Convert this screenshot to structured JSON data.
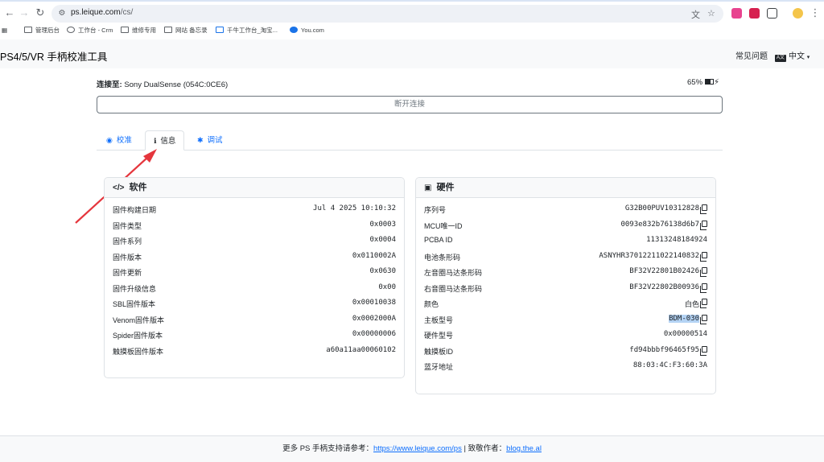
{
  "browser": {
    "url_host": "ps.leique.com",
    "url_path": "/cs/",
    "bookmarks": [
      "管理后台",
      "工作台 - Crm",
      "维修专用",
      "网站 备忘录",
      "千牛工作台_淘宝...",
      "You.com"
    ]
  },
  "app": {
    "title": "PS4/5/VR 手柄校准工具",
    "faq": "常见问题",
    "language": "中文"
  },
  "connection": {
    "label": "连接至:",
    "device": "Sony DualSense (054C:0CE6)",
    "battery": "65%",
    "disconnect": "断开连接"
  },
  "tabs": [
    {
      "label": "校准",
      "icon": "gamepad-icon"
    },
    {
      "label": "信息",
      "icon": "info-icon"
    },
    {
      "label": "调试",
      "icon": "bug-icon"
    }
  ],
  "software": {
    "title": "软件",
    "rows": [
      {
        "k": "固件构建日期",
        "v": "Jul 4 2025 10:10:32"
      },
      {
        "k": "固件类型",
        "v": "0x0003"
      },
      {
        "k": "固件系列",
        "v": "0x0004"
      },
      {
        "k": "固件版本",
        "v": "0x0110002A"
      },
      {
        "k": "固件更新",
        "v": "0x0630"
      },
      {
        "k": "固件升级信息",
        "v": "0x00"
      },
      {
        "k": "SBL固件版本",
        "v": "0x00010038"
      },
      {
        "k": "Venom固件版本",
        "v": "0x0002000A"
      },
      {
        "k": "Spider固件版本",
        "v": "0x00000006"
      },
      {
        "k": "触摸板固件版本",
        "v": "a60a11aa00060102"
      }
    ]
  },
  "hardware": {
    "title": "硬件",
    "rows": [
      {
        "k": "序列号",
        "v": "G32B00PUV10312828",
        "copy": true
      },
      {
        "k": "MCU唯一ID",
        "v": "0093e832b76138d6b7",
        "copy": true
      },
      {
        "k": "PCBA ID",
        "v": "11313248184924",
        "copy": false
      },
      {
        "k": "电池条形码",
        "v": "ASNYHR37012211022140832",
        "copy": true
      },
      {
        "k": "左音圈马达条形码",
        "v": "BF32V22801B02426",
        "copy": true
      },
      {
        "k": "右音圈马达条形码",
        "v": "BF32V22802B00936",
        "copy": true
      },
      {
        "k": "颜色",
        "v": "白色",
        "copy": true
      },
      {
        "k": "主板型号",
        "v": "BDM-030",
        "copy": true,
        "highlight": true
      },
      {
        "k": "硬件型号",
        "v": "0x00000514",
        "copy": false
      },
      {
        "k": "触摸板ID",
        "v": "fd94bbbf96465f95",
        "copy": true
      },
      {
        "k": "蓝牙地址",
        "v": "88:03:4C:F3:60:3A",
        "copy": false
      }
    ]
  },
  "footer": {
    "text": "更多 PS 手柄支持请参考：",
    "link1": "https://www.leique.com/ps",
    "sep": " | 致敬作者：",
    "link2": "blog.the.al"
  }
}
